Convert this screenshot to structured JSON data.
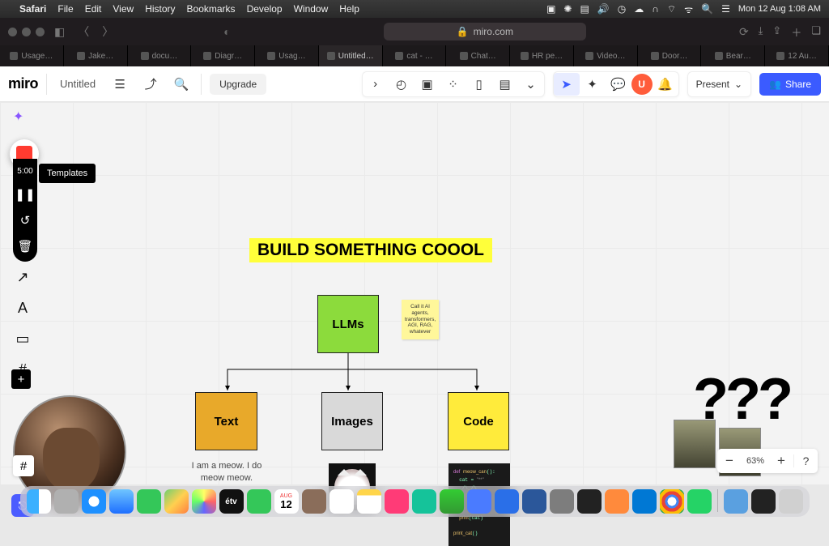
{
  "menubar": {
    "app": "Safari",
    "items": [
      "File",
      "Edit",
      "View",
      "History",
      "Bookmarks",
      "Develop",
      "Window",
      "Help"
    ],
    "clock": "Mon 12 Aug 1:08 AM"
  },
  "safari": {
    "url_host": "miro.com",
    "lock_icon": "🔒"
  },
  "tabs": [
    "Usage…",
    "Jake…",
    "docu…",
    "Diagr…",
    "Usag…",
    "Untitled…",
    "cat - …",
    "Chat…",
    "HR pe…",
    "Video…",
    "Door…",
    "Bear…",
    "12 Au…"
  ],
  "miro": {
    "logo": "miro",
    "board_name": "Untitled",
    "upgrade": "Upgrade",
    "present": "Present",
    "share": "Share",
    "avatar_letter": "U",
    "zoom": "63%"
  },
  "recorder": {
    "time": "5:00",
    "templates_tooltip": "Templates"
  },
  "diagram": {
    "title": "BUILD SOMETHING COOOL",
    "root": "LLMs",
    "sticky": "Call it AI agents, transformers, AGI, RAG, whatever",
    "children": [
      {
        "label": "Text",
        "caption": "I am a meow. I do meow meow."
      },
      {
        "label": "Images"
      },
      {
        "label": "Code"
      }
    ],
    "code_snippet": "def meow_can():\n  cat = \"**\"\n   /\\_/\\\n  ( o.o )\n   > ^ <\n  ***\n  print(cat)\n\nprint_cat()",
    "question": "???"
  },
  "zoom": {
    "minus": "−",
    "plus": "+",
    "help": "?"
  },
  "dock_cal": {
    "month": "AUG",
    "day": "12"
  },
  "dock_tv": "étv",
  "chart_data": {
    "type": "diagram",
    "title": "BUILD SOMETHING COOOL",
    "nodes": [
      {
        "id": "root",
        "label": "LLMs",
        "note": "Call it AI agents, transformers, AGI, RAG, whatever"
      },
      {
        "id": "text",
        "label": "Text",
        "example": "I am a meow. I do meow meow."
      },
      {
        "id": "images",
        "label": "Images",
        "example": "cat photo"
      },
      {
        "id": "code",
        "label": "Code",
        "example": "def meow_can(): ... print(cat) print_cat()"
      }
    ],
    "edges": [
      {
        "from": "root",
        "to": "text"
      },
      {
        "from": "root",
        "to": "images"
      },
      {
        "from": "root",
        "to": "code"
      }
    ],
    "annotation": "???"
  }
}
